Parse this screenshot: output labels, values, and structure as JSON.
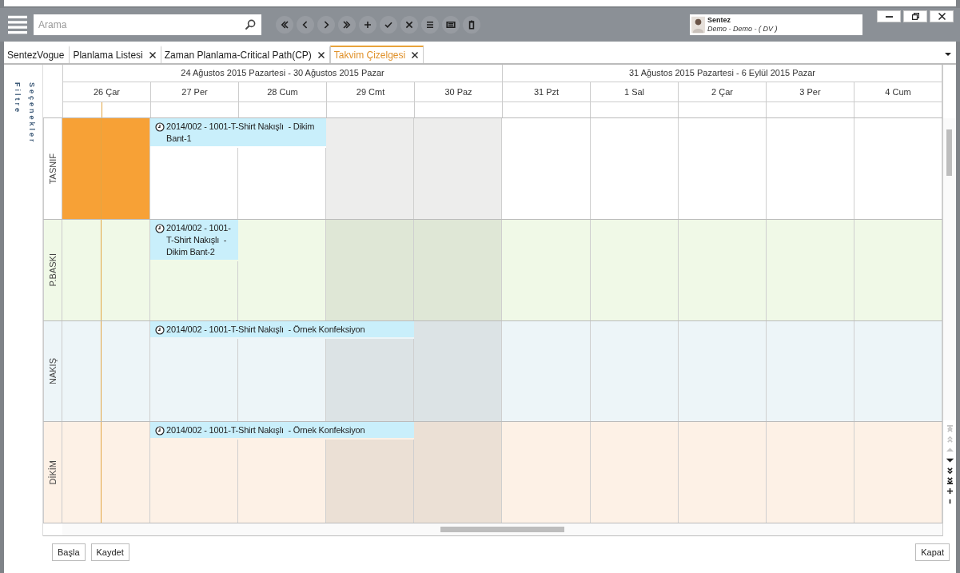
{
  "search": {
    "placeholder": "Arama"
  },
  "user": {
    "name": "Sentez",
    "subtitle": "Demo - Demo - ( DV )"
  },
  "tabs": [
    {
      "label": "SentezVogue",
      "selected": false,
      "closable": false
    },
    {
      "label": "Planlama Listesi",
      "selected": false,
      "closable": true
    },
    {
      "label": "Zaman Planlama-Critical Path(CP)",
      "selected": false,
      "closable": true
    },
    {
      "label": "Takvim Çizelgesi",
      "selected": true,
      "closable": true
    }
  ],
  "filter_panel": {
    "labels": [
      "Filtre",
      "Seçenekler"
    ]
  },
  "calendar": {
    "weeks": [
      {
        "label": "24 Ağustos 2015 Pazartesi - 30 Ağustos 2015 Pazar",
        "days": [
          {
            "label": "26 Çar",
            "weekend": false,
            "today": true
          },
          {
            "label": "27 Per",
            "weekend": false,
            "today": false
          },
          {
            "label": "28 Cum",
            "weekend": false,
            "today": false
          },
          {
            "label": "29 Cmt",
            "weekend": true,
            "today": false
          },
          {
            "label": "30 Paz",
            "weekend": true,
            "today": false
          }
        ]
      },
      {
        "label": "31 Ağustos 2015 Pazartesi - 6 Eylül 2015 Pazar",
        "days": [
          {
            "label": "31 Pzt",
            "weekend": false,
            "today": false
          },
          {
            "label": "1 Sal",
            "weekend": false,
            "today": false
          },
          {
            "label": "2 Çar",
            "weekend": false,
            "today": false
          },
          {
            "label": "3 Per",
            "weekend": false,
            "today": false
          },
          {
            "label": "4 Cum",
            "weekend": false,
            "today": false
          }
        ]
      }
    ],
    "rows": [
      {
        "label": "TASNIF",
        "color": "#ffffff",
        "cells": [
          {
            "blocked": true,
            "covered": false
          },
          {
            "blocked": false,
            "covered": false,
            "event": {
              "text": "2014/002 - 1001-T-Shirt Nakışlı  - Dikim Bant-1"
            }
          },
          {
            "blocked": false,
            "covered": true
          },
          {
            "blocked": false,
            "covered": false
          },
          {
            "blocked": false,
            "covered": false
          },
          {
            "blocked": false,
            "covered": false
          },
          {
            "blocked": false,
            "covered": false
          },
          {
            "blocked": false,
            "covered": false
          },
          {
            "blocked": false,
            "covered": false
          },
          {
            "blocked": false,
            "covered": false
          }
        ]
      },
      {
        "label": "P.BASKI",
        "color": "#f0f9e7",
        "cells": [
          {
            "blocked": false,
            "covered": false
          },
          {
            "blocked": false,
            "covered": false,
            "event": {
              "text": "2014/002 - 1001-T-Shirt Nakışlı  - Dikim Bant-2"
            }
          },
          {
            "blocked": false,
            "covered": false
          },
          {
            "blocked": false,
            "covered": false
          },
          {
            "blocked": false,
            "covered": false
          },
          {
            "blocked": false,
            "covered": false
          },
          {
            "blocked": false,
            "covered": false
          },
          {
            "blocked": false,
            "covered": false
          },
          {
            "blocked": false,
            "covered": false
          },
          {
            "blocked": false,
            "covered": false
          }
        ]
      },
      {
        "label": "NAKIŞ",
        "color": "#edf5f8",
        "cells": [
          {
            "blocked": false,
            "covered": false
          },
          {
            "blocked": false,
            "covered": false,
            "event": {
              "text": "2014/002 - 1001-T-Shirt Nakışlı  - Örnek Konfeksiyon"
            }
          },
          {
            "blocked": false,
            "covered": true
          },
          {
            "blocked": false,
            "covered": true
          },
          {
            "blocked": false,
            "covered": false
          },
          {
            "blocked": false,
            "covered": false
          },
          {
            "blocked": false,
            "covered": false
          },
          {
            "blocked": false,
            "covered": false
          },
          {
            "blocked": false,
            "covered": false
          },
          {
            "blocked": false,
            "covered": false
          }
        ]
      },
      {
        "label": "DİKİM",
        "color": "#fdf1e6",
        "cells": [
          {
            "blocked": false,
            "covered": false
          },
          {
            "blocked": false,
            "covered": false,
            "event": {
              "text": "2014/002 - 1001-T-Shirt Nakışlı  - Örnek Konfeksiyon"
            }
          },
          {
            "blocked": false,
            "covered": true
          },
          {
            "blocked": false,
            "covered": true
          },
          {
            "blocked": false,
            "covered": false
          },
          {
            "blocked": false,
            "covered": false
          },
          {
            "blocked": false,
            "covered": false
          },
          {
            "blocked": false,
            "covered": false
          },
          {
            "blocked": false,
            "covered": false
          },
          {
            "blocked": false,
            "covered": false
          }
        ]
      }
    ]
  },
  "row_navigation": [
    {
      "kind": "first",
      "disabled": true
    },
    {
      "kind": "page-up",
      "disabled": true
    },
    {
      "kind": "up",
      "disabled": true
    },
    {
      "kind": "down",
      "disabled": false
    },
    {
      "kind": "page-down",
      "disabled": false
    },
    {
      "kind": "last",
      "disabled": false
    },
    {
      "kind": "add",
      "disabled": false
    },
    {
      "kind": "remove",
      "disabled": false
    }
  ],
  "buttons": {
    "left": [
      "Başla",
      "Kaydet"
    ],
    "right": [
      "Kapat"
    ]
  }
}
